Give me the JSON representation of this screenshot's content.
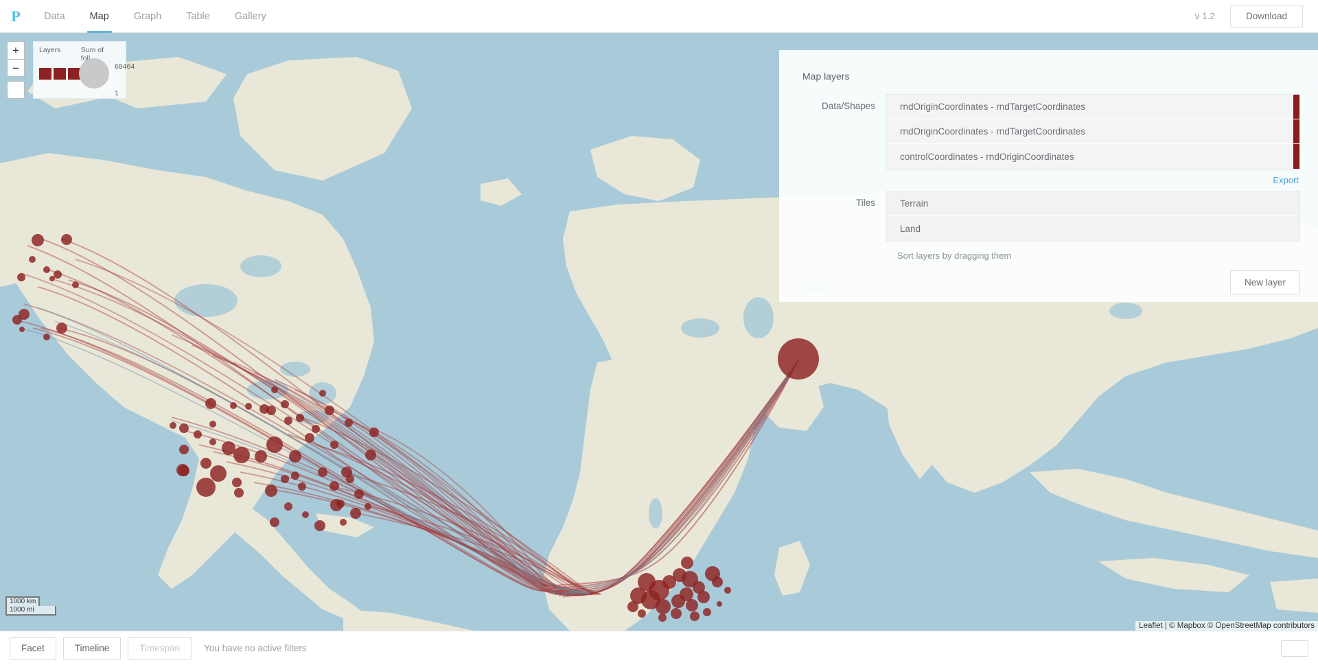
{
  "header": {
    "logo": "P",
    "tabs": [
      {
        "label": "Data",
        "active": false
      },
      {
        "label": "Map",
        "active": true
      },
      {
        "label": "Graph",
        "active": false
      },
      {
        "label": "Table",
        "active": false
      },
      {
        "label": "Gallery",
        "active": false
      }
    ],
    "version": "v 1.2",
    "download_label": "Download"
  },
  "map": {
    "zoom_in_label": "+",
    "zoom_out_label": "−",
    "scale_km": "1000 km",
    "scale_mi": "1000 mi",
    "attribution": "Leaflet | © Mapbox © OpenStreetMap contributors",
    "land_color": "#e9e7d8",
    "water_color": "#a9cbd9",
    "marker_color": "#8e2222",
    "arc_color": "#a63a3a"
  },
  "legend": {
    "layers_label": "Layers",
    "size_label": "Sum of foll...",
    "swatch_color": "#8e2222",
    "size_max": "68464",
    "size_min": "1"
  },
  "layers_panel": {
    "title": "Map layers",
    "data_shapes_label": "Data/Shapes",
    "data_shapes": [
      {
        "label": "rndOriginCoordinates - rndTargetCoordinates",
        "color": "#8B1C1C"
      },
      {
        "label": "rndOriginCoordinates - rndTargetCoordinates",
        "color": "#8B1C1C"
      },
      {
        "label": "controlCoordinates - rndOriginCoordinates",
        "color": "#8B1C1C"
      }
    ],
    "export_label": "Export",
    "tiles_label": "Tiles",
    "tiles": [
      {
        "label": "Terrain"
      },
      {
        "label": "Land"
      }
    ],
    "sort_hint": "Sort layers by dragging them",
    "new_layer_label": "New layer"
  },
  "bottom_bar": {
    "facet_label": "Facet",
    "timeline_label": "Timeline",
    "timespan_label": "Timespan",
    "filter_message": "You have no active filters"
  }
}
